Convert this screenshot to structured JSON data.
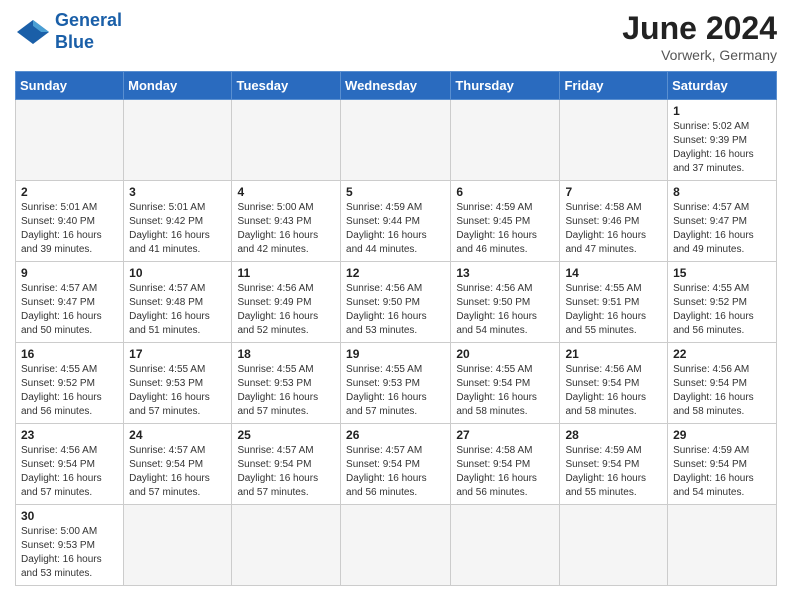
{
  "header": {
    "logo_general": "General",
    "logo_blue": "Blue",
    "month": "June 2024",
    "location": "Vorwerk, Germany"
  },
  "days_of_week": [
    "Sunday",
    "Monday",
    "Tuesday",
    "Wednesday",
    "Thursday",
    "Friday",
    "Saturday"
  ],
  "weeks": [
    [
      {
        "day": "",
        "info": ""
      },
      {
        "day": "",
        "info": ""
      },
      {
        "day": "",
        "info": ""
      },
      {
        "day": "",
        "info": ""
      },
      {
        "day": "",
        "info": ""
      },
      {
        "day": "",
        "info": ""
      },
      {
        "day": "1",
        "info": "Sunrise: 5:02 AM\nSunset: 9:39 PM\nDaylight: 16 hours and 37 minutes."
      }
    ],
    [
      {
        "day": "2",
        "info": "Sunrise: 5:01 AM\nSunset: 9:40 PM\nDaylight: 16 hours and 39 minutes."
      },
      {
        "day": "3",
        "info": "Sunrise: 5:01 AM\nSunset: 9:42 PM\nDaylight: 16 hours and 41 minutes."
      },
      {
        "day": "4",
        "info": "Sunrise: 5:00 AM\nSunset: 9:43 PM\nDaylight: 16 hours and 42 minutes."
      },
      {
        "day": "5",
        "info": "Sunrise: 4:59 AM\nSunset: 9:44 PM\nDaylight: 16 hours and 44 minutes."
      },
      {
        "day": "6",
        "info": "Sunrise: 4:59 AM\nSunset: 9:45 PM\nDaylight: 16 hours and 46 minutes."
      },
      {
        "day": "7",
        "info": "Sunrise: 4:58 AM\nSunset: 9:46 PM\nDaylight: 16 hours and 47 minutes."
      },
      {
        "day": "8",
        "info": "Sunrise: 4:57 AM\nSunset: 9:47 PM\nDaylight: 16 hours and 49 minutes."
      }
    ],
    [
      {
        "day": "9",
        "info": "Sunrise: 4:57 AM\nSunset: 9:47 PM\nDaylight: 16 hours and 50 minutes."
      },
      {
        "day": "10",
        "info": "Sunrise: 4:57 AM\nSunset: 9:48 PM\nDaylight: 16 hours and 51 minutes."
      },
      {
        "day": "11",
        "info": "Sunrise: 4:56 AM\nSunset: 9:49 PM\nDaylight: 16 hours and 52 minutes."
      },
      {
        "day": "12",
        "info": "Sunrise: 4:56 AM\nSunset: 9:50 PM\nDaylight: 16 hours and 53 minutes."
      },
      {
        "day": "13",
        "info": "Sunrise: 4:56 AM\nSunset: 9:50 PM\nDaylight: 16 hours and 54 minutes."
      },
      {
        "day": "14",
        "info": "Sunrise: 4:55 AM\nSunset: 9:51 PM\nDaylight: 16 hours and 55 minutes."
      },
      {
        "day": "15",
        "info": "Sunrise: 4:55 AM\nSunset: 9:52 PM\nDaylight: 16 hours and 56 minutes."
      }
    ],
    [
      {
        "day": "16",
        "info": "Sunrise: 4:55 AM\nSunset: 9:52 PM\nDaylight: 16 hours and 56 minutes."
      },
      {
        "day": "17",
        "info": "Sunrise: 4:55 AM\nSunset: 9:53 PM\nDaylight: 16 hours and 57 minutes."
      },
      {
        "day": "18",
        "info": "Sunrise: 4:55 AM\nSunset: 9:53 PM\nDaylight: 16 hours and 57 minutes."
      },
      {
        "day": "19",
        "info": "Sunrise: 4:55 AM\nSunset: 9:53 PM\nDaylight: 16 hours and 57 minutes."
      },
      {
        "day": "20",
        "info": "Sunrise: 4:55 AM\nSunset: 9:54 PM\nDaylight: 16 hours and 58 minutes."
      },
      {
        "day": "21",
        "info": "Sunrise: 4:56 AM\nSunset: 9:54 PM\nDaylight: 16 hours and 58 minutes."
      },
      {
        "day": "22",
        "info": "Sunrise: 4:56 AM\nSunset: 9:54 PM\nDaylight: 16 hours and 58 minutes."
      }
    ],
    [
      {
        "day": "23",
        "info": "Sunrise: 4:56 AM\nSunset: 9:54 PM\nDaylight: 16 hours and 57 minutes."
      },
      {
        "day": "24",
        "info": "Sunrise: 4:57 AM\nSunset: 9:54 PM\nDaylight: 16 hours and 57 minutes."
      },
      {
        "day": "25",
        "info": "Sunrise: 4:57 AM\nSunset: 9:54 PM\nDaylight: 16 hours and 57 minutes."
      },
      {
        "day": "26",
        "info": "Sunrise: 4:57 AM\nSunset: 9:54 PM\nDaylight: 16 hours and 56 minutes."
      },
      {
        "day": "27",
        "info": "Sunrise: 4:58 AM\nSunset: 9:54 PM\nDaylight: 16 hours and 56 minutes."
      },
      {
        "day": "28",
        "info": "Sunrise: 4:59 AM\nSunset: 9:54 PM\nDaylight: 16 hours and 55 minutes."
      },
      {
        "day": "29",
        "info": "Sunrise: 4:59 AM\nSunset: 9:54 PM\nDaylight: 16 hours and 54 minutes."
      }
    ],
    [
      {
        "day": "30",
        "info": "Sunrise: 5:00 AM\nSunset: 9:53 PM\nDaylight: 16 hours and 53 minutes."
      },
      {
        "day": "",
        "info": ""
      },
      {
        "day": "",
        "info": ""
      },
      {
        "day": "",
        "info": ""
      },
      {
        "day": "",
        "info": ""
      },
      {
        "day": "",
        "info": ""
      },
      {
        "day": "",
        "info": ""
      }
    ]
  ]
}
